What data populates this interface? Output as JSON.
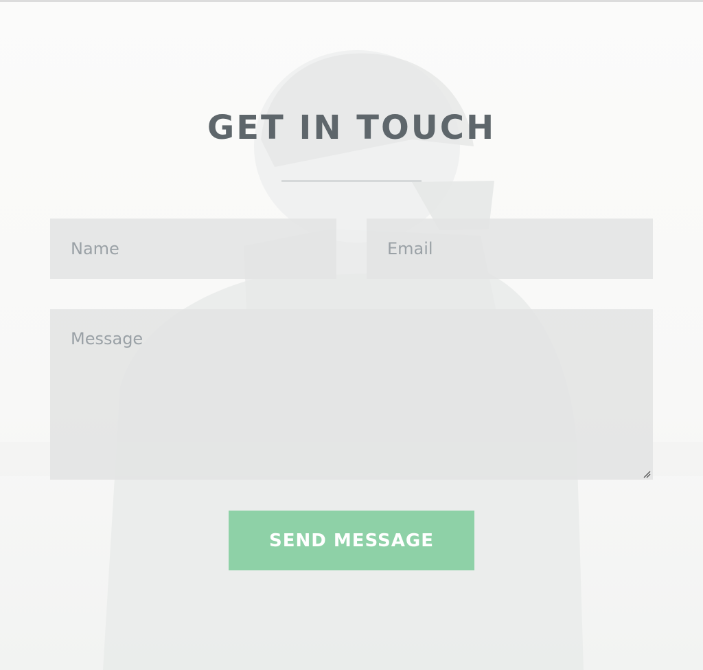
{
  "contact": {
    "title": "GET IN TOUCH",
    "name_placeholder": "Name",
    "email_placeholder": "Email",
    "message_placeholder": "Message",
    "send_label": "SEND MESSAGE"
  },
  "colors": {
    "title": "#5e666b",
    "field_bg": "#e2e4e4",
    "placeholder": "#9aa1a6",
    "button_bg": "#8ed1a7",
    "button_text": "#ffffff"
  },
  "icons": {
    "resize": "resize-grip-icon"
  }
}
